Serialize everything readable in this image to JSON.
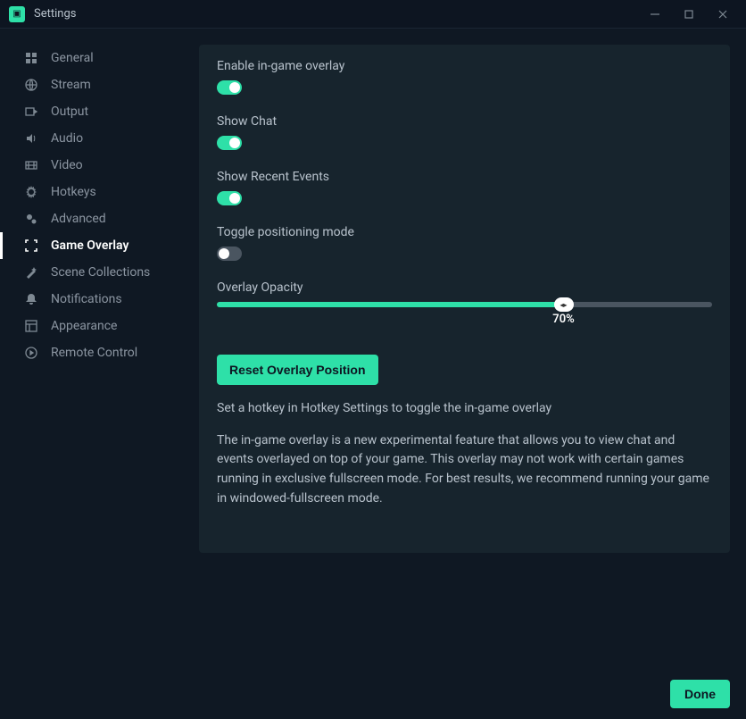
{
  "window": {
    "title": "Settings"
  },
  "sidebar": {
    "items": [
      {
        "label": "General"
      },
      {
        "label": "Stream"
      },
      {
        "label": "Output"
      },
      {
        "label": "Audio"
      },
      {
        "label": "Video"
      },
      {
        "label": "Hotkeys"
      },
      {
        "label": "Advanced"
      },
      {
        "label": "Game Overlay"
      },
      {
        "label": "Scene Collections"
      },
      {
        "label": "Notifications"
      },
      {
        "label": "Appearance"
      },
      {
        "label": "Remote Control"
      }
    ],
    "active_index": 7
  },
  "settings": {
    "enable_overlay": {
      "label": "Enable in-game overlay",
      "on": true
    },
    "show_chat": {
      "label": "Show Chat",
      "on": true
    },
    "show_recent": {
      "label": "Show Recent Events",
      "on": true
    },
    "positioning": {
      "label": "Toggle positioning mode",
      "on": false
    },
    "opacity": {
      "label": "Overlay Opacity",
      "value": 70,
      "display": "70%"
    },
    "reset_label": "Reset Overlay Position",
    "hint": "Set a hotkey in Hotkey Settings to toggle the in-game overlay",
    "description": "The in-game overlay is a new experimental feature that allows you to view chat and events overlayed on top of your game. This overlay may not work with certain games running in exclusive fullscreen mode. For best results, we recommend running your game in windowed-fullscreen mode."
  },
  "footer": {
    "done": "Done"
  }
}
